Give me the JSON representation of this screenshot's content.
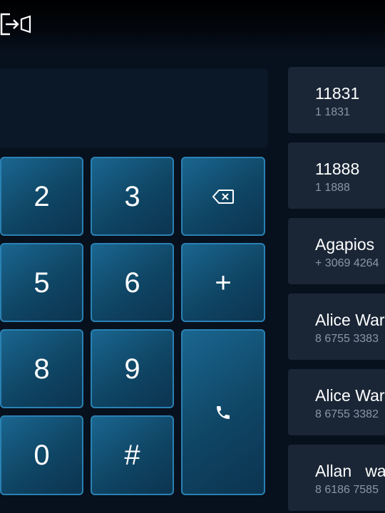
{
  "header": {
    "exit_icon": "exit-icon"
  },
  "dialpad": {
    "keys": [
      "2",
      "3",
      "5",
      "6",
      "+",
      "8",
      "9",
      "0",
      "#"
    ],
    "backspace_icon": "backspace-icon",
    "call_icon": "phone-icon"
  },
  "contacts": [
    {
      "name": "11831",
      "number": "1 1831"
    },
    {
      "name": "11888",
      "number": "1 1888"
    },
    {
      "name": "Agapios",
      "number": "+ 3069 4264"
    },
    {
      "name": "Alice War",
      "number": "8 6755 3383"
    },
    {
      "name": "Alice War",
      "number": "8 6755 3382"
    },
    {
      "name": "Allan   wa",
      "number": "8 6186 7585"
    }
  ]
}
